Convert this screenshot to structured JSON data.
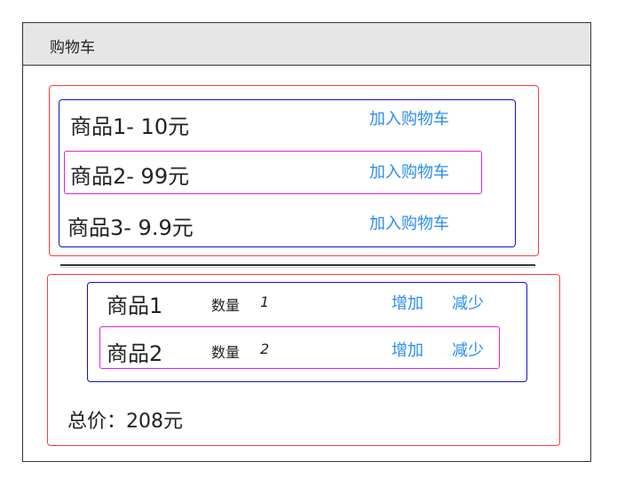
{
  "window": {
    "title": "购物车"
  },
  "products": [
    {
      "label": "商品1- 10元",
      "action": "加入购物车"
    },
    {
      "label": "商品2- 99元",
      "action": "加入购物车"
    },
    {
      "label": "商品3- 9.9元",
      "action": "加入购物车"
    }
  ],
  "cart": {
    "items": [
      {
        "name": "商品1",
        "qty_label": "数量",
        "qty": "1",
        "add": "增加",
        "remove": "减少"
      },
      {
        "name": "商品2",
        "qty_label": "数量",
        "qty": "2",
        "add": "增加",
        "remove": "减少"
      }
    ],
    "total_label": "总价：208元"
  },
  "colors": {
    "outer_box": "#ff3b3b",
    "list_box": "#1010d0",
    "highlight_box": "#e020e0",
    "link": "#2a8cf0"
  }
}
